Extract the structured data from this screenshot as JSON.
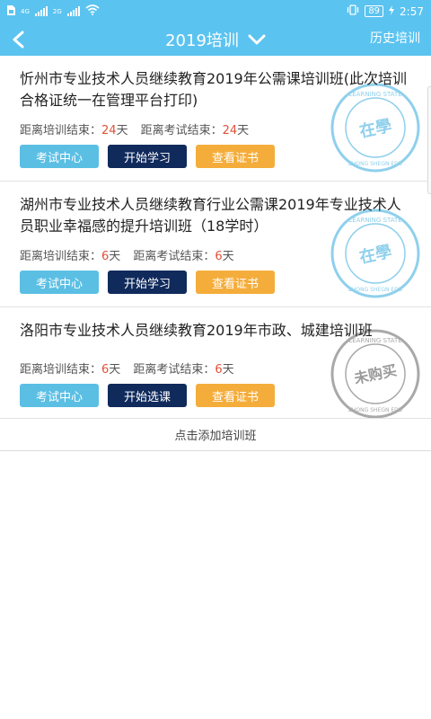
{
  "status_bar": {
    "left_icons": [
      "sim-card-icon",
      "signal-icon",
      "signal-icon",
      "wifi-icon"
    ],
    "net1": "4G",
    "net2": "2G",
    "battery": "89",
    "time": "2:57"
  },
  "header": {
    "title": "2019培训",
    "history_label": "历史培训",
    "bg_color": "#5bc3f0"
  },
  "courses": [
    {
      "title": "忻州市专业技术人员继续教育2019年公需课培训班(此次培训合格证统一在管理平台打印)",
      "train_end_label": "距离培训结束：",
      "train_end_days": "24",
      "exam_end_label": "距离考试结束：",
      "exam_end_days": "24",
      "day_unit": "天",
      "btn_exam": "考试中心",
      "btn_start": "开始学习",
      "btn_cert": "查看证书",
      "stamp_text": "在學",
      "stamp_top": "LEARNING STATE",
      "stamp_bottom": "ZHONG SHEGN EDU",
      "stamp_color": "#8fd0ec"
    },
    {
      "title": "湖州市专业技术人员继续教育行业公需课2019年专业技术人员职业幸福感的提升培训班（18学时）",
      "train_end_label": "距离培训结束：",
      "train_end_days": "6",
      "exam_end_label": "距离考试结束：",
      "exam_end_days": "6",
      "day_unit": "天",
      "btn_exam": "考试中心",
      "btn_start": "开始学习",
      "btn_cert": "查看证书",
      "stamp_text": "在學",
      "stamp_top": "LEARNING STATE",
      "stamp_bottom": "ZHONG SHEGN EDU",
      "stamp_color": "#8fd0ec"
    },
    {
      "title": "洛阳市专业技术人员继续教育2019年市政、城建培训班",
      "train_end_label": "距离培训结束：",
      "train_end_days": "6",
      "exam_end_label": "距离考试结束：",
      "exam_end_days": "6",
      "day_unit": "天",
      "btn_exam": "考试中心",
      "btn_start": "开始选课",
      "btn_cert": "查看证书",
      "stamp_text": "未购买",
      "stamp_top": "LEARNING STATE",
      "stamp_bottom": "ZHONG SHEGN EDU",
      "stamp_color": "#a9a9a9"
    }
  ],
  "add_label": "点击添加培训班"
}
